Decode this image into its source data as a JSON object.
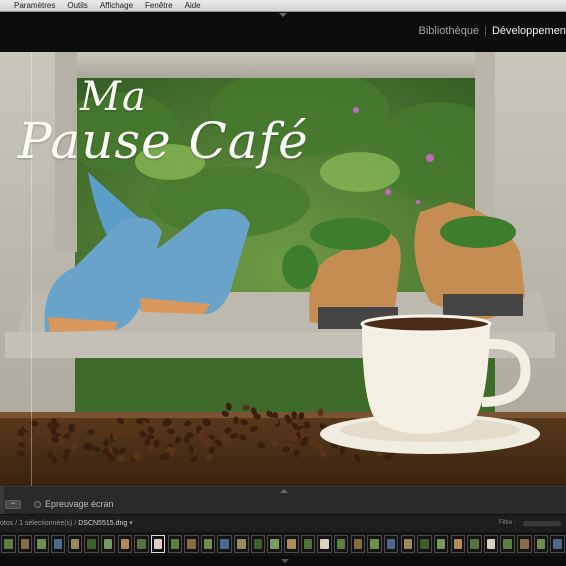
{
  "menubar": {
    "items": [
      "Paramètres",
      "Outils",
      "Affichage",
      "Fenêtre",
      "Aide"
    ]
  },
  "modules": {
    "items": [
      {
        "label": "Bibliothèque",
        "active": false
      },
      {
        "label": "Développement",
        "active": true
      }
    ]
  },
  "photo": {
    "title_line1": "Ma",
    "title_line2": "Pause Café"
  },
  "toolbar": {
    "proof_label": "Epreuvage écran"
  },
  "filmstrip": {
    "info_prefix": "otos / 1 sélectionnée(s) /",
    "selected_file": "DSCN5515.dng",
    "filter_label": "Filtre :",
    "thumbnail_count": 34,
    "selected_index": 9
  },
  "colors": {
    "active_module": "#f2f2f2",
    "inactive_module": "#a5a5a5",
    "panel_bg": "#2a2a2a"
  }
}
